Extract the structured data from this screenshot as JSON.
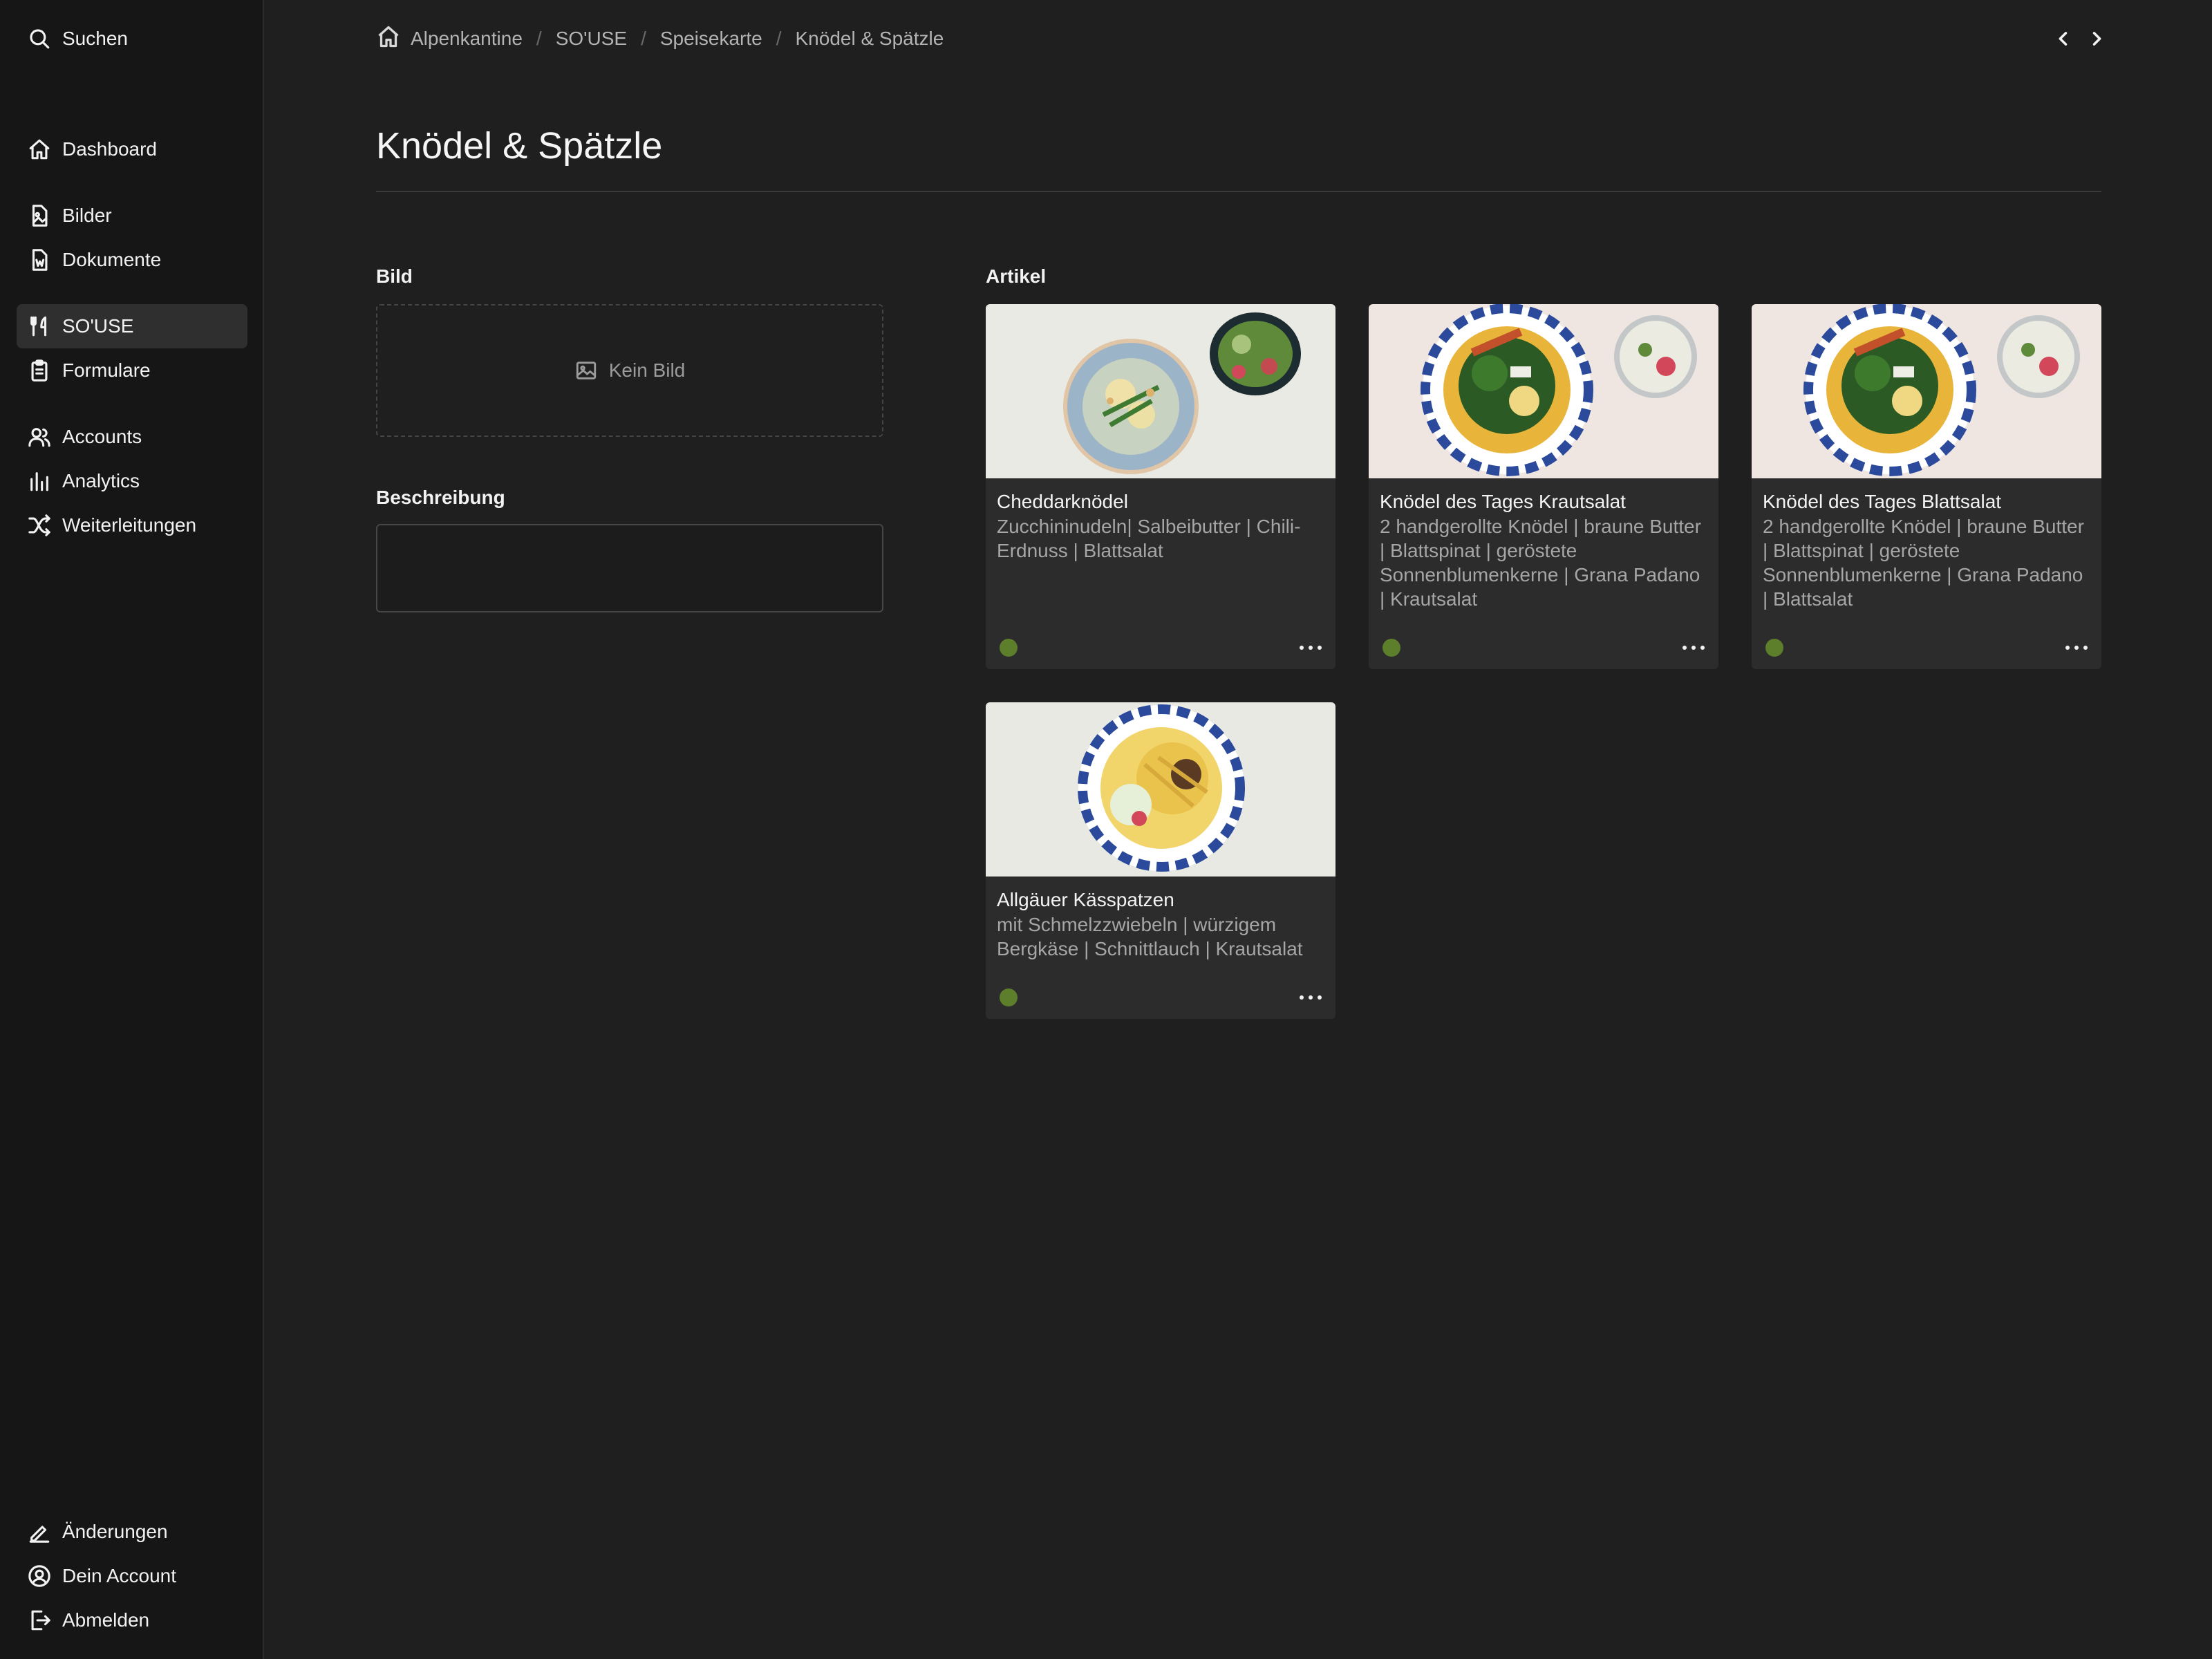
{
  "sidebar": {
    "search_label": "Suchen",
    "items": [
      {
        "label": "Dashboard",
        "icon": "home-icon"
      },
      {
        "label": "Bilder",
        "icon": "image-file-icon"
      },
      {
        "label": "Dokumente",
        "icon": "document-icon"
      },
      {
        "label": "SO'USE",
        "icon": "fork-knife-icon",
        "active": true
      },
      {
        "label": "Formulare",
        "icon": "clipboard-icon"
      },
      {
        "label": "Accounts",
        "icon": "users-icon"
      },
      {
        "label": "Analytics",
        "icon": "bar-chart-icon"
      },
      {
        "label": "Weiterleitungen",
        "icon": "shuffle-icon"
      }
    ],
    "bottom": [
      {
        "label": "Änderungen",
        "icon": "pencil-icon"
      },
      {
        "label": "Dein Account",
        "icon": "user-circle-icon"
      },
      {
        "label": "Abmelden",
        "icon": "logout-icon"
      }
    ]
  },
  "breadcrumb": [
    "Alpenkantine",
    "SO'USE",
    "Speisekarte",
    "Knödel & Spätzle"
  ],
  "page": {
    "title": "Knödel & Spätzle",
    "image_label": "Bild",
    "no_image_text": "Kein Bild",
    "description_label": "Beschreibung",
    "description_value": "",
    "articles_label": "Artikel"
  },
  "articles": [
    {
      "name": "Cheddarknödel",
      "description": "Zucchininudeln| Salbeibutter | Chili-Erdnuss | Blattsalat",
      "status_color": "#5d7f2c"
    },
    {
      "name": "Knödel des Tages Krautsalat",
      "description": "2 handgerollte Knödel | braune Butter | Blattspinat | geröstete Sonnenblumenkerne | Grana Padano | Krautsalat",
      "status_color": "#5d7f2c"
    },
    {
      "name": "Knödel des Tages Blattsalat",
      "description": "2 handgerollte Knödel | braune Butter | Blattspinat | geröstete Sonnenblumenkerne | Grana Padano | Blattsalat",
      "status_color": "#5d7f2c"
    },
    {
      "name": "Allgäuer Kässpatzen",
      "description": "mit Schmelzzwiebeln | würzigem Bergkäse | Schnittlauch | Krautsalat",
      "status_color": "#5d7f2c"
    }
  ],
  "colors": {
    "sidebar_bg": "#161616",
    "main_bg": "#1f1f1f",
    "card_bg": "#2c2c2c",
    "status_active": "#5d7f2c"
  }
}
